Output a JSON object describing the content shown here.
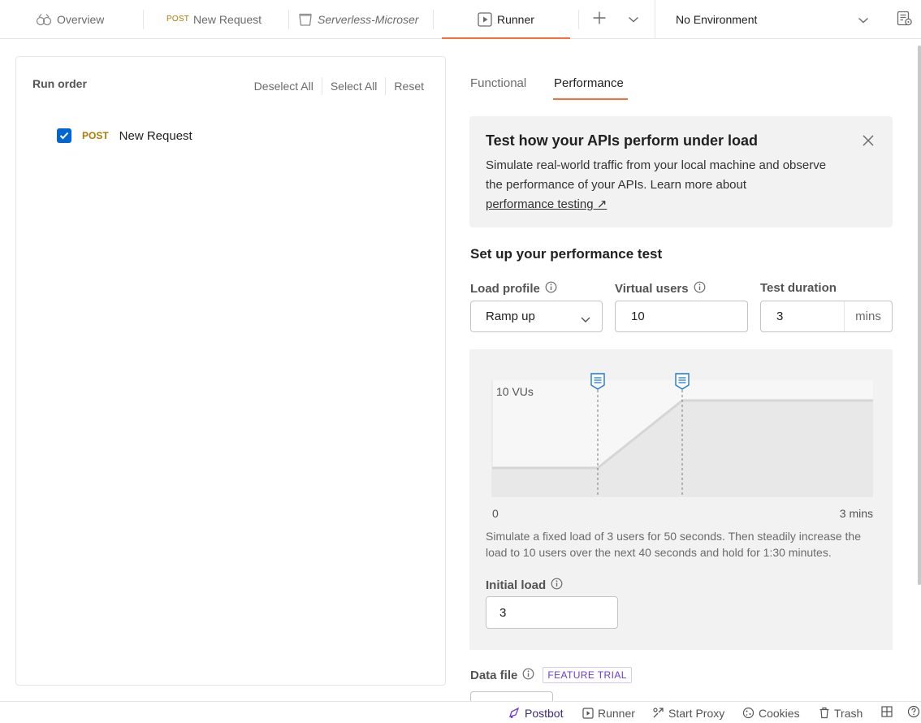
{
  "tabs": [
    {
      "label": "Overview"
    },
    {
      "method": "POST",
      "label": "New Request"
    },
    {
      "label": "Serverless-Microser"
    },
    {
      "label": "Runner"
    }
  ],
  "environment": {
    "selected": "No Environment"
  },
  "run_panel": {
    "title": "Run order",
    "actions": [
      "Deselect All",
      "Select All",
      "Reset"
    ],
    "requests": [
      {
        "method": "POST",
        "name": "New Request",
        "checked": true
      }
    ]
  },
  "mode_tabs": [
    "Functional",
    "Performance"
  ],
  "banner": {
    "title": "Test how your APIs perform under load",
    "body": "Simulate real-world traffic from your local machine and observe the performance of your APIs. Learn more about",
    "link": "performance testing ↗"
  },
  "setup": {
    "title": "Set up your performance test",
    "load_profile_label": "Load profile",
    "load_profile_value": "Ramp up",
    "virtual_users_label": "Virtual users",
    "virtual_users_value": "10",
    "duration_label": "Test duration",
    "duration_value": "3",
    "duration_unit": "mins"
  },
  "load_chart": {
    "y_label": "10 VUs",
    "x_start": "0",
    "x_end": "3 mins",
    "description": "Simulate a fixed load of 3 users for 50 seconds. Then steadily increase the load to 10 users over the next 40 seconds and hold for 1:30 minutes.",
    "initial_load_label": "Initial load",
    "initial_load_value": "3"
  },
  "data_file": {
    "label": "Data file",
    "badge": "FEATURE TRIAL"
  },
  "statusbar": {
    "postbot": "Postbot",
    "runner": "Runner",
    "proxy": "Start Proxy",
    "cookies": "Cookies",
    "trash": "Trash"
  },
  "colors": {
    "accent": "#ff6c37",
    "checkbox": "#0265d2",
    "post_method": "#ad7a03",
    "marker": "#1f77d6"
  }
}
